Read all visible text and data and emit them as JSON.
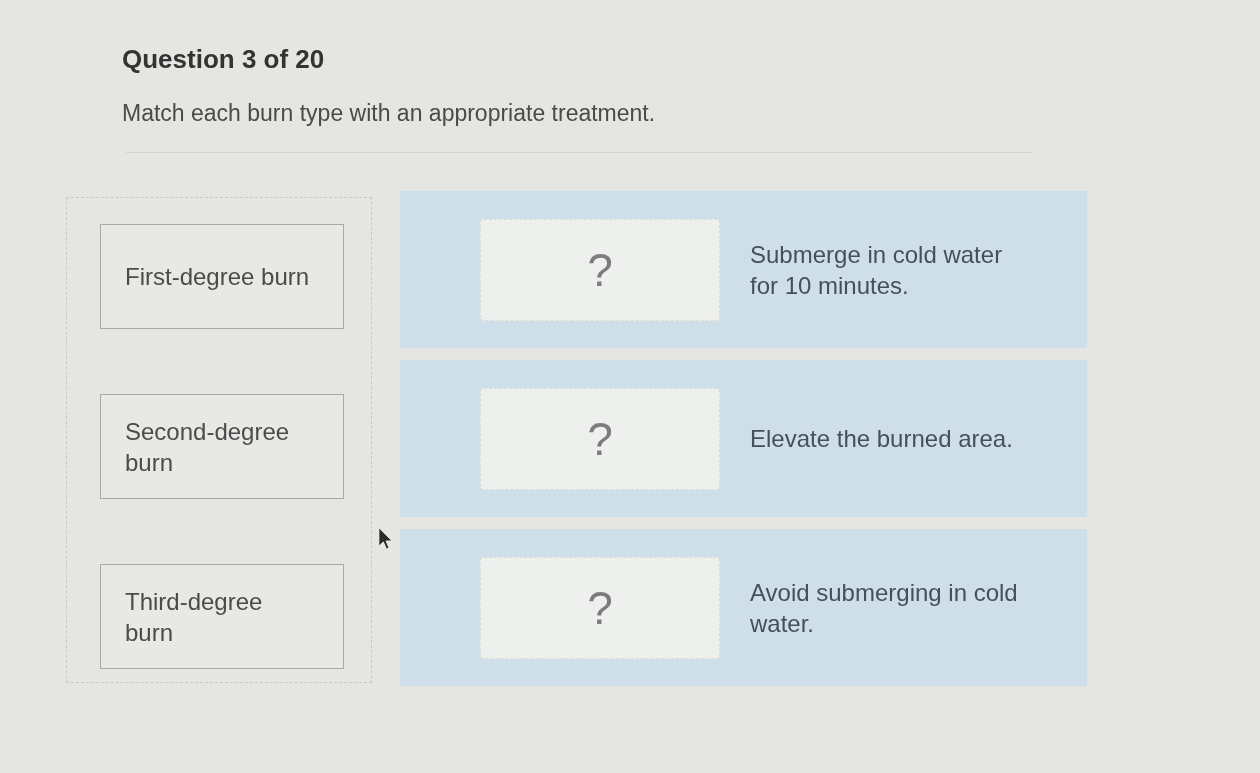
{
  "question": {
    "counter": "Question 3 of 20",
    "instruction": "Match each burn type with an appropriate treatment."
  },
  "answer_bank": [
    {
      "label": "First-degree burn"
    },
    {
      "label": "Second-degree burn"
    },
    {
      "label": "Third-degree burn"
    }
  ],
  "targets": [
    {
      "slot": "?",
      "treatment": "Submerge in cold water for 10 minutes."
    },
    {
      "slot": "?",
      "treatment": "Elevate the burned area."
    },
    {
      "slot": "?",
      "treatment": "Avoid submerging in cold water."
    }
  ]
}
